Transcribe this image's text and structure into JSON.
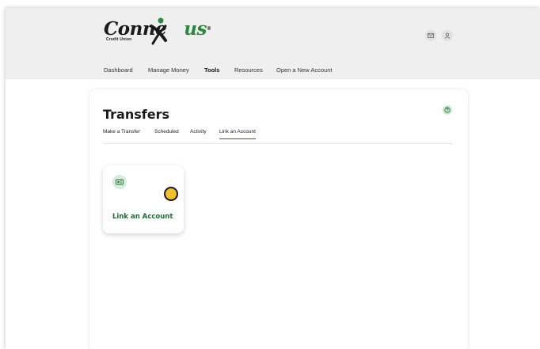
{
  "brand": {
    "logo_text_main": "Conne",
    "logo_text_accent": "us",
    "logo_mark": "®",
    "logo_subtitle": "Credit Union"
  },
  "header_icons": [
    "mail-icon",
    "user-icon"
  ],
  "nav": {
    "items": [
      {
        "label": "Dashboard",
        "active": false
      },
      {
        "label": "Manage Money",
        "active": false
      },
      {
        "label": "Tools",
        "active": true
      },
      {
        "label": "Resources",
        "active": false
      },
      {
        "label": "Open a New Account",
        "active": false
      }
    ]
  },
  "page": {
    "title": "Transfers",
    "help_icon": "help-icon"
  },
  "tabs": [
    {
      "label": "Make a Transfer",
      "active": false
    },
    {
      "label": "Scheduled",
      "active": false
    },
    {
      "label": "Activity",
      "active": false
    },
    {
      "label": "Link an Account",
      "active": true
    }
  ],
  "link_card": {
    "icon": "link-account-icon",
    "label": "Link an Account"
  },
  "colors": {
    "accent": "#1f6b35",
    "header_bg": "#efefef",
    "indicator": "#f2bf2d"
  }
}
